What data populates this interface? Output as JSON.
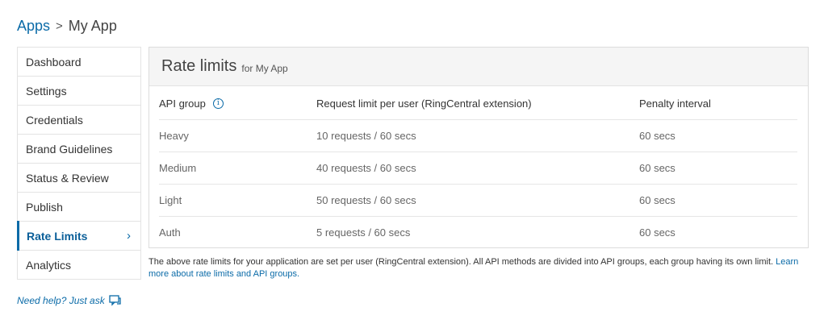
{
  "breadcrumb": {
    "root": "Apps",
    "separator": ">",
    "current": "My App"
  },
  "sidebar": {
    "items": [
      {
        "label": "Dashboard"
      },
      {
        "label": "Settings"
      },
      {
        "label": "Credentials"
      },
      {
        "label": "Brand Guidelines"
      },
      {
        "label": "Status & Review"
      },
      {
        "label": "Publish"
      },
      {
        "label": "Rate Limits",
        "active": true
      },
      {
        "label": "Analytics"
      }
    ],
    "active_chevron": "›"
  },
  "help": {
    "label": "Need help? Just ask",
    "icon": "chat-bubble-icon"
  },
  "panel": {
    "title": "Rate limits",
    "subtitle": "for My App",
    "columns": [
      "API group",
      "Request limit per user (RingCentral extension)",
      "Penalty interval"
    ],
    "info_icon": "i",
    "rows": [
      [
        "Heavy",
        "10 requests / 60 secs",
        "60 secs"
      ],
      [
        "Medium",
        "40 requests / 60 secs",
        "60 secs"
      ],
      [
        "Light",
        "50 requests / 60 secs",
        "60 secs"
      ],
      [
        "Auth",
        "5 requests / 60 secs",
        "60 secs"
      ]
    ]
  },
  "note": {
    "text": "The above rate limits for your application are set per user (RingCentral extension). All API methods are divided into API groups, each group having its own limit.",
    "link": "Learn more about rate limits and API groups."
  },
  "colors": {
    "accent": "#0b6ba8",
    "header_bg": "#f5f5f5",
    "border": "#e3e3e3"
  }
}
